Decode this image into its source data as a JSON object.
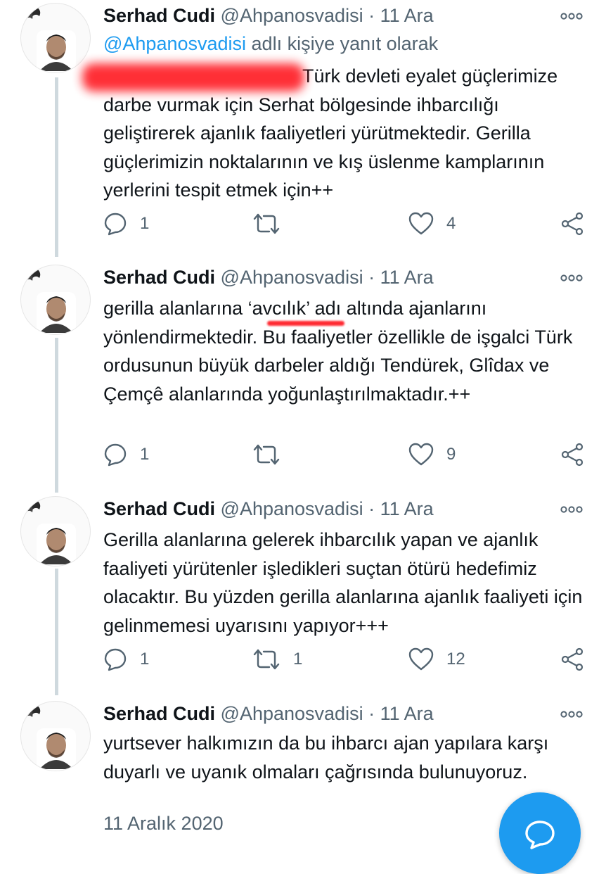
{
  "colors": {
    "accent": "#1d9bf0",
    "secondary_text": "#536471",
    "highlight": "#ff1e26"
  },
  "tweets": [
    {
      "name": "Serhad Cudi",
      "handle": "@Ahpanosvadisi",
      "separator": "·",
      "date": "11 Ara",
      "replying_mention": "@Ahpanosvadisi",
      "replying_suffix": " adlı kişiye yanıt olarak",
      "text": "Türk devleti eyalet güçlerimize darbe vurmak için Serhat bölgesinde ihbarcılığı geliştirerek ajanlık faaliyetleri yürütmektedir. Gerilla güçlerimizin noktalarının ve kış üslenme kamplarının yerlerini tespit etmek için++",
      "replies": "1",
      "retweets": "",
      "likes": "4"
    },
    {
      "name": "Serhad Cudi",
      "handle": "@Ahpanosvadisi",
      "separator": "·",
      "date": "11 Ara",
      "text": "gerilla alanlarına ‘avcılık’ adı altında ajanlarını yönlendirmektedir. Bu faaliyetler özellikle de işgalci Türk ordusunun büyük darbeler aldığı Tendürek, Glîdax ve Çemçê alanlarında yoğunlaştırılmaktadır.++",
      "replies": "1",
      "retweets": "",
      "likes": "9"
    },
    {
      "name": "Serhad Cudi",
      "handle": "@Ahpanosvadisi",
      "separator": "·",
      "date": "11 Ara",
      "text": "Gerilla alanlarına gelerek ihbarcılık yapan ve ajanlık faaliyeti yürütenler işledikleri suçtan ötürü hedefimiz olacaktır. Bu yüzden gerilla alanlarına ajanlık faaliyeti için gelinmemesi uyarısını yapıyor+++",
      "replies": "1",
      "retweets": "1",
      "likes": "12"
    },
    {
      "name": "Serhad Cudi",
      "handle": "@Ahpanosvadisi",
      "separator": "·",
      "date": "11 Ara",
      "text": "yurtsever halkımızın da bu ihbarcı ajan yapılara karşı duyarlı ve uyanık olmaları çağrısında bulunuyoruz."
    }
  ],
  "timestamp": "11 Aralık 2020",
  "icons": {
    "avatar": "avatar-icon",
    "more": "more-icon",
    "reply": "reply-icon",
    "retweet": "retweet-icon",
    "like": "like-icon",
    "share": "share-icon",
    "compose": "compose-fab-icon"
  }
}
